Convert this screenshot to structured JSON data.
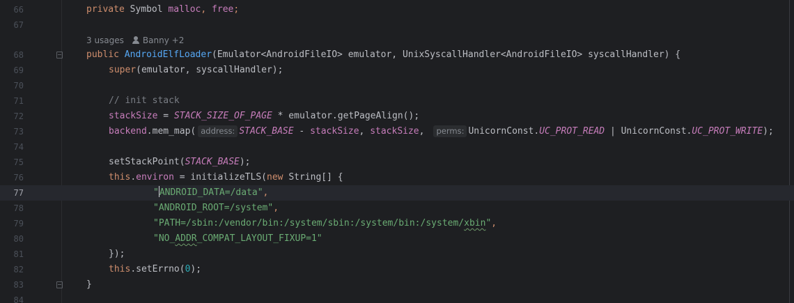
{
  "editor": {
    "lines": {
      "l66": {
        "num": "66",
        "t1": "private ",
        "t2": "Symbol ",
        "t3": "malloc",
        "t4": ", ",
        "t5": "free",
        "t6": ";"
      },
      "l67": {
        "num": "67"
      },
      "lens": {
        "usages": "3 usages",
        "authors": "Banny +2",
        "icon": "person-icon"
      },
      "l68": {
        "num": "68",
        "t1": "public ",
        "t2": "AndroidElfLoader",
        "t3": "(Emulator<AndroidFileIO> emulator, UnixSyscallHandler<AndroidFileIO> syscallHandler) {"
      },
      "l69": {
        "num": "69",
        "t1": "super",
        "t2": "(emulator, syscallHandler);"
      },
      "l70": {
        "num": "70"
      },
      "l71": {
        "num": "71",
        "t1": "// init stack"
      },
      "l72": {
        "num": "72",
        "t1": "stackSize",
        "t2": " = ",
        "t3": "STACK_SIZE_OF_PAGE",
        "t4": " * emulator.getPageAlign();"
      },
      "l73": {
        "num": "73",
        "t1": "backend",
        "t2": ".mem_map(",
        "h1": "address:",
        "t3": "STACK_BASE",
        "t4": " - ",
        "t5": "stackSize",
        "t6": ", ",
        "t7": "stackSize",
        "t8": ",",
        "h2": "perms:",
        "t9": "UnicornConst.",
        "t10": "UC_PROT_READ",
        "t11": " | UnicornConst.",
        "t12": "UC_PROT_WRITE",
        "t13": ");"
      },
      "l74": {
        "num": "74"
      },
      "l75": {
        "num": "75",
        "t1": "setStackPoint(",
        "t2": "STACK_BASE",
        "t3": ");"
      },
      "l76": {
        "num": "76",
        "t1": "this",
        "t2": ".",
        "t3": "environ",
        "t4": " = initializeTLS(",
        "t5": "new ",
        "t6": "String[] {"
      },
      "l77": {
        "num": "77",
        "t1": "\"",
        "t2": "ANDROID_DATA=/data\"",
        "t3": ","
      },
      "l78": {
        "num": "78",
        "t1": "\"ANDROID_ROOT=/system\"",
        "t2": ","
      },
      "l79": {
        "num": "79",
        "t1": "\"PATH=/sbin:/vendor/bin:/system/sbin:/system/bin:/system/",
        "t2": "xbin",
        "t3": "\"",
        "t4": ","
      },
      "l80": {
        "num": "80",
        "t1": "\"NO_",
        "t2": "ADDR",
        "t3": "_COMPAT_LAYOUT_FIXUP=1\""
      },
      "l81": {
        "num": "81",
        "t1": "});"
      },
      "l82": {
        "num": "82",
        "t1": "this",
        "t2": ".setErrno(",
        "t3": "0",
        "t4": ");"
      },
      "l83": {
        "num": "83",
        "t1": "}"
      },
      "l84": {
        "num": "84"
      }
    },
    "current_line": "77",
    "colors": {
      "background": "#1e1f22",
      "keyword": "#cf8e6d",
      "function": "#56a8f5",
      "field": "#c77dbb",
      "string": "#6aab73",
      "number": "#2aacb8",
      "comment": "#7a7e85",
      "text": "#bcbec4"
    }
  }
}
